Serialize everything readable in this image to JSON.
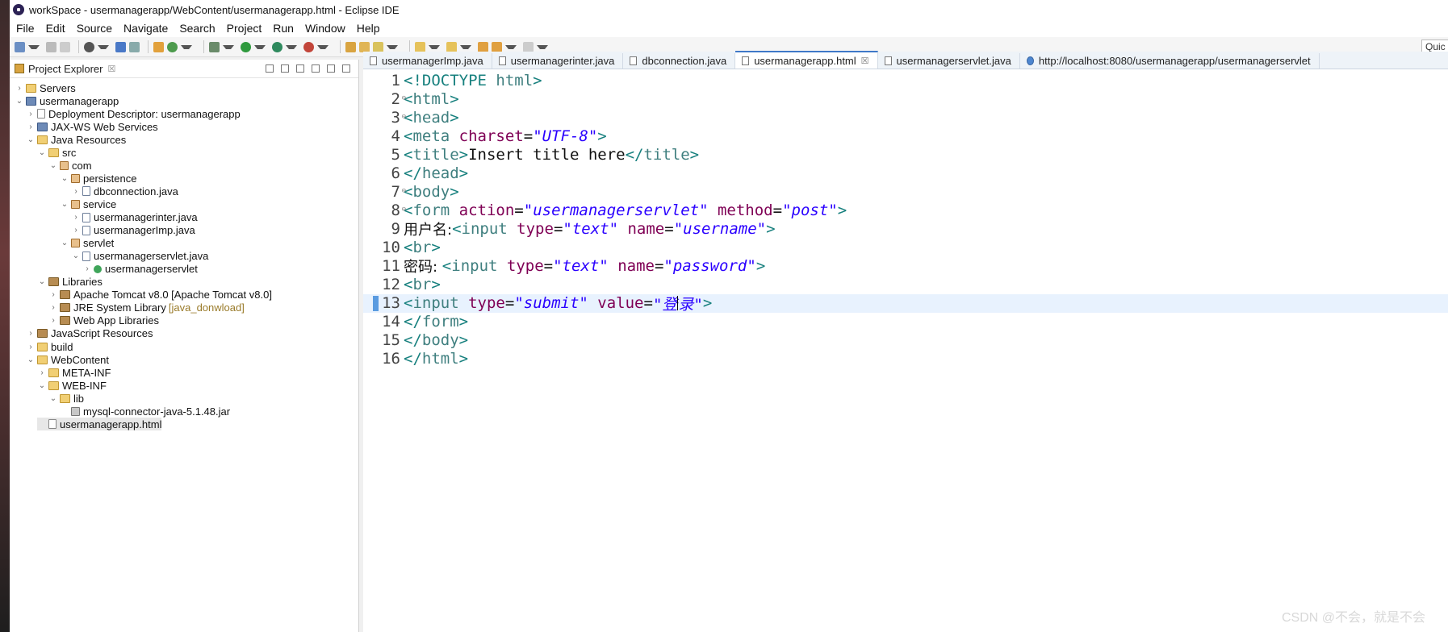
{
  "window": {
    "title": "workSpace - usermanagerapp/WebContent/usermanagerapp.html - Eclipse IDE"
  },
  "menu": [
    "File",
    "Edit",
    "Source",
    "Navigate",
    "Search",
    "Project",
    "Run",
    "Window",
    "Help"
  ],
  "quick_access": "Quic",
  "explorer": {
    "title": "Project Explorer",
    "close": "☒",
    "items": [
      {
        "label": "Servers",
        "depth": 0,
        "chev": "›",
        "icon": "folder"
      },
      {
        "label": "usermanagerapp",
        "depth": 0,
        "chev": "⌄",
        "icon": "proj"
      },
      {
        "label": "Deployment Descriptor: usermanagerapp",
        "depth": 1,
        "chev": "›",
        "icon": "file"
      },
      {
        "label": "JAX-WS Web Services",
        "depth": 1,
        "chev": "›",
        "icon": "proj"
      },
      {
        "label": "Java Resources",
        "depth": 1,
        "chev": "⌄",
        "icon": "folder"
      },
      {
        "label": "src",
        "depth": 2,
        "chev": "⌄",
        "icon": "folder"
      },
      {
        "label": "com",
        "depth": 3,
        "chev": "⌄",
        "icon": "pkg"
      },
      {
        "label": "persistence",
        "depth": 4,
        "chev": "⌄",
        "icon": "pkg"
      },
      {
        "label": "dbconnection.java",
        "depth": 5,
        "chev": "›",
        "icon": "java"
      },
      {
        "label": "service",
        "depth": 4,
        "chev": "⌄",
        "icon": "pkg"
      },
      {
        "label": "usermanagerinter.java",
        "depth": 5,
        "chev": "›",
        "icon": "java"
      },
      {
        "label": "usermanagerImp.java",
        "depth": 5,
        "chev": "›",
        "icon": "java"
      },
      {
        "label": "servlet",
        "depth": 4,
        "chev": "⌄",
        "icon": "pkg"
      },
      {
        "label": "usermanagerservlet.java",
        "depth": 5,
        "chev": "⌄",
        "icon": "java"
      },
      {
        "label": "usermanagerservlet",
        "depth": 6,
        "chev": "›",
        "icon": "cls"
      },
      {
        "label": "Libraries",
        "depth": 2,
        "chev": "⌄",
        "icon": "lib"
      },
      {
        "label": "Apache Tomcat v8.0 [Apache Tomcat v8.0]",
        "depth": 3,
        "chev": "›",
        "icon": "lib"
      },
      {
        "label": "JRE System Library",
        "extra": "[java_donwload]",
        "depth": 3,
        "chev": "›",
        "icon": "lib"
      },
      {
        "label": "Web App Libraries",
        "depth": 3,
        "chev": "›",
        "icon": "lib"
      },
      {
        "label": "JavaScript Resources",
        "depth": 1,
        "chev": "›",
        "icon": "lib"
      },
      {
        "label": "build",
        "depth": 1,
        "chev": "›",
        "icon": "folder"
      },
      {
        "label": "WebContent",
        "depth": 1,
        "chev": "⌄",
        "icon": "folder"
      },
      {
        "label": "META-INF",
        "depth": 2,
        "chev": "›",
        "icon": "folder"
      },
      {
        "label": "WEB-INF",
        "depth": 2,
        "chev": "⌄",
        "icon": "folder"
      },
      {
        "label": "lib",
        "depth": 3,
        "chev": "⌄",
        "icon": "folder"
      },
      {
        "label": "mysql-connector-java-5.1.48.jar",
        "depth": 4,
        "chev": "",
        "icon": "jar"
      },
      {
        "label": "usermanagerapp.html",
        "depth": 2,
        "chev": "",
        "icon": "file",
        "selected": true
      }
    ]
  },
  "tabs": [
    {
      "label": "usermanagerImp.java",
      "active": false,
      "kind": "java"
    },
    {
      "label": "usermanagerinter.java",
      "active": false,
      "kind": "java"
    },
    {
      "label": "dbconnection.java",
      "active": false,
      "kind": "java"
    },
    {
      "label": "usermanagerapp.html",
      "active": true,
      "kind": "html",
      "close": "☒"
    },
    {
      "label": "usermanagerservlet.java",
      "active": false,
      "kind": "java"
    },
    {
      "label": "http://localhost:8080/usermanagerapp/usermanagerservlet",
      "active": false,
      "kind": "web"
    }
  ],
  "code": [
    {
      "n": "1",
      "parts": [
        [
          "tg",
          "<!DOCTYPE "
        ],
        [
          "tn",
          "html"
        ],
        [
          "tg",
          ">"
        ]
      ]
    },
    {
      "n": "2",
      "fold": true,
      "parts": [
        [
          "tg",
          "<"
        ],
        [
          "tn",
          "html"
        ],
        [
          "tg",
          ">"
        ]
      ]
    },
    {
      "n": "3",
      "fold": true,
      "parts": [
        [
          "tg",
          "<"
        ],
        [
          "tn",
          "head"
        ],
        [
          "tg",
          ">"
        ]
      ]
    },
    {
      "n": "4",
      "parts": [
        [
          "tg",
          "<"
        ],
        [
          "tn",
          "meta "
        ],
        [
          "at",
          "charset"
        ],
        [
          "pl",
          "="
        ],
        [
          "av",
          "\"UTF-8\""
        ],
        [
          "tg",
          ">"
        ]
      ]
    },
    {
      "n": "5",
      "parts": [
        [
          "tg",
          "<"
        ],
        [
          "tn",
          "title"
        ],
        [
          "tg",
          ">"
        ],
        [
          "pl",
          "Insert title here"
        ],
        [
          "tg",
          "</"
        ],
        [
          "tn",
          "title"
        ],
        [
          "tg",
          ">"
        ]
      ]
    },
    {
      "n": "6",
      "parts": [
        [
          "tg",
          "</"
        ],
        [
          "tn",
          "head"
        ],
        [
          "tg",
          ">"
        ]
      ]
    },
    {
      "n": "7",
      "fold": true,
      "parts": [
        [
          "tg",
          "<"
        ],
        [
          "tn",
          "body"
        ],
        [
          "tg",
          ">"
        ]
      ]
    },
    {
      "n": "8",
      "fold": true,
      "parts": [
        [
          "tg",
          "<"
        ],
        [
          "tn",
          "form "
        ],
        [
          "at",
          "action"
        ],
        [
          "pl",
          "="
        ],
        [
          "av",
          "\"usermanagerservlet\""
        ],
        [
          "pl",
          " "
        ],
        [
          "at",
          "method"
        ],
        [
          "pl",
          "="
        ],
        [
          "av",
          "\"post\""
        ],
        [
          "tg",
          ">"
        ]
      ]
    },
    {
      "n": "9",
      "parts": [
        [
          "pl cn",
          "用户名:"
        ],
        [
          "tg",
          "<"
        ],
        [
          "tn",
          "input "
        ],
        [
          "at",
          "type"
        ],
        [
          "pl",
          "="
        ],
        [
          "av",
          "\"text\""
        ],
        [
          "pl",
          " "
        ],
        [
          "at",
          "name"
        ],
        [
          "pl",
          "="
        ],
        [
          "av",
          "\"username\""
        ],
        [
          "tg",
          ">"
        ]
      ]
    },
    {
      "n": "10",
      "parts": [
        [
          "tg",
          "<"
        ],
        [
          "tn",
          "br"
        ],
        [
          "tg",
          ">"
        ]
      ]
    },
    {
      "n": "11",
      "parts": [
        [
          "pl cn",
          "密码: "
        ],
        [
          "tg",
          "<"
        ],
        [
          "tn",
          "input "
        ],
        [
          "at",
          "type"
        ],
        [
          "pl",
          "="
        ],
        [
          "av",
          "\"text\""
        ],
        [
          "pl",
          " "
        ],
        [
          "at",
          "name"
        ],
        [
          "pl",
          "="
        ],
        [
          "av",
          "\"password\""
        ],
        [
          "tg",
          ">"
        ]
      ]
    },
    {
      "n": "12",
      "parts": [
        [
          "tg",
          "<"
        ],
        [
          "tn",
          "br"
        ],
        [
          "tg",
          ">"
        ]
      ]
    },
    {
      "n": "13",
      "current": true,
      "parts": [
        [
          "tg",
          "<"
        ],
        [
          "tn",
          "input "
        ],
        [
          "at",
          "type"
        ],
        [
          "pl",
          "="
        ],
        [
          "av",
          "\"submit\""
        ],
        [
          "pl",
          " "
        ],
        [
          "at",
          "value"
        ],
        [
          "pl",
          "="
        ],
        [
          "av",
          "\"登"
        ],
        [
          "cursor",
          ""
        ],
        [
          "av",
          "录\""
        ],
        [
          "tg",
          ">"
        ]
      ]
    },
    {
      "n": "14",
      "parts": [
        [
          "tg",
          "</"
        ],
        [
          "tn",
          "form"
        ],
        [
          "tg",
          ">"
        ]
      ]
    },
    {
      "n": "15",
      "parts": [
        [
          "tg",
          "</"
        ],
        [
          "tn",
          "body"
        ],
        [
          "tg",
          ">"
        ]
      ]
    },
    {
      "n": "16",
      "parts": [
        [
          "tg",
          "</"
        ],
        [
          "tn",
          "html"
        ],
        [
          "tg",
          ">"
        ]
      ]
    }
  ],
  "watermark": "CSDN @不会，就是不会"
}
